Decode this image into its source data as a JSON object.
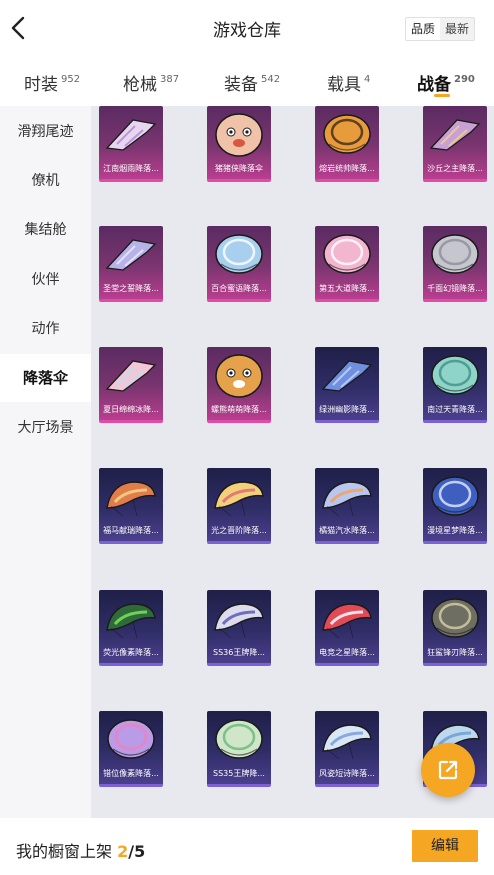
{
  "header": {
    "title": "游戏仓库",
    "sort_options": [
      "品质",
      "最新"
    ],
    "sort_active": "品质"
  },
  "tabs": [
    {
      "label": "时装",
      "count": "952"
    },
    {
      "label": "枪械",
      "count": "387"
    },
    {
      "label": "装备",
      "count": "542"
    },
    {
      "label": "载具",
      "count": "4"
    },
    {
      "label": "战备",
      "count": "290",
      "active": true
    }
  ],
  "sidebar": {
    "items": [
      {
        "label": "滑翔尾迹"
      },
      {
        "label": "僚机"
      },
      {
        "label": "集结舱"
      },
      {
        "label": "伙伴"
      },
      {
        "label": "动作"
      },
      {
        "label": "降落伞",
        "active": true
      },
      {
        "label": "大厅场景"
      }
    ]
  },
  "items": [
    {
      "name": "江南烟雨降落...",
      "rarity": "pink",
      "canopy": "#e8d6f0",
      "accent": "#b18ad1",
      "icon": "glider"
    },
    {
      "name": "猪猪侠降落伞",
      "rarity": "pink",
      "canopy": "#f0c2a8",
      "accent": "#d8573f",
      "icon": "face"
    },
    {
      "name": "熔岩统帅降落...",
      "rarity": "pink",
      "canopy": "#e89b3b",
      "accent": "#3a2a1c",
      "icon": "round"
    },
    {
      "name": "沙丘之主降落...",
      "rarity": "pink",
      "canopy": "#c9a0d6",
      "accent": "#f0d27a",
      "icon": "glider"
    },
    {
      "name": "圣堂之誓降落...",
      "rarity": "pink",
      "canopy": "#b7b3e6",
      "accent": "#ece8ff",
      "icon": "glider"
    },
    {
      "name": "百合蜜语降落...",
      "rarity": "pink",
      "canopy": "#a8d0ee",
      "accent": "#ffffff",
      "icon": "round"
    },
    {
      "name": "第五大道降落...",
      "rarity": "pink",
      "canopy": "#f2b6cf",
      "accent": "#ffffff",
      "icon": "round"
    },
    {
      "name": "千面幻镜降落...",
      "rarity": "pink",
      "canopy": "#c6c6cf",
      "accent": "#8d8d99",
      "icon": "round"
    },
    {
      "name": "夏日绵绵冰降...",
      "rarity": "pink",
      "canopy": "#f4c6d6",
      "accent": "#b3e2f2",
      "icon": "glider"
    },
    {
      "name": "螺熊萌萌降落...",
      "rarity": "pink",
      "canopy": "#e6a24a",
      "accent": "#ffffff",
      "icon": "face"
    },
    {
      "name": "绿洲幽影降落...",
      "rarity": "purple",
      "canopy": "#6f8fe0",
      "accent": "#c3d3ff",
      "icon": "glider"
    },
    {
      "name": "南过天青降落...",
      "rarity": "purple",
      "canopy": "#8fd4c9",
      "accent": "#3f8f86",
      "icon": "round"
    },
    {
      "name": "福马献瑞降落...",
      "rarity": "purple",
      "canopy": "#e07d4a",
      "accent": "#f5d58a",
      "icon": "wing"
    },
    {
      "name": "光之晋阶降落...",
      "rarity": "purple",
      "canopy": "#f3d07a",
      "accent": "#e06a7a",
      "icon": "wing"
    },
    {
      "name": "橘猫汽水降落...",
      "rarity": "purple",
      "canopy": "#b9c7f0",
      "accent": "#f2a25a",
      "icon": "wing"
    },
    {
      "name": "漫境星梦降落...",
      "rarity": "purple",
      "canopy": "#3e5fbf",
      "accent": "#e6ecff",
      "icon": "round"
    },
    {
      "name": "荧光像素降落...",
      "rarity": "purple",
      "canopy": "#2f6b3a",
      "accent": "#7be35c",
      "icon": "wing"
    },
    {
      "name": "SS36王牌降...",
      "rarity": "purple",
      "canopy": "#dcdcee",
      "accent": "#5a5ab0",
      "icon": "wing"
    },
    {
      "name": "电竞之星降落...",
      "rarity": "purple",
      "canopy": "#e24a58",
      "accent": "#ffffff",
      "icon": "wing"
    },
    {
      "name": "狂鲨锋刃降落...",
      "rarity": "purple",
      "canopy": "#6e6e62",
      "accent": "#d8d2a8",
      "icon": "round"
    },
    {
      "name": "错位像素降落...",
      "rarity": "purple",
      "canopy": "#b99be8",
      "accent": "#f27fb7",
      "icon": "round"
    },
    {
      "name": "SS35王牌降...",
      "rarity": "purple",
      "canopy": "#cfe6c9",
      "accent": "#6ab57a",
      "icon": "round"
    },
    {
      "name": "风姿短诗降落...",
      "rarity": "purple",
      "canopy": "#d8e6f5",
      "accent": "#7a9ed8",
      "icon": "wing"
    },
    {
      "name": "",
      "rarity": "purple",
      "canopy": "#bcd8ee",
      "accent": "#6f9fd0",
      "icon": "wing"
    }
  ],
  "bottom": {
    "label_prefix": "我的橱窗上架",
    "current": "2",
    "total": "/5",
    "edit_label": "编辑"
  },
  "icons": {
    "back": "chevron-left-icon",
    "share": "share-external-icon"
  },
  "colors": {
    "accent": "#f5a623",
    "rarity_pink": "#e24aa7",
    "rarity_purple": "#7a62d6"
  }
}
